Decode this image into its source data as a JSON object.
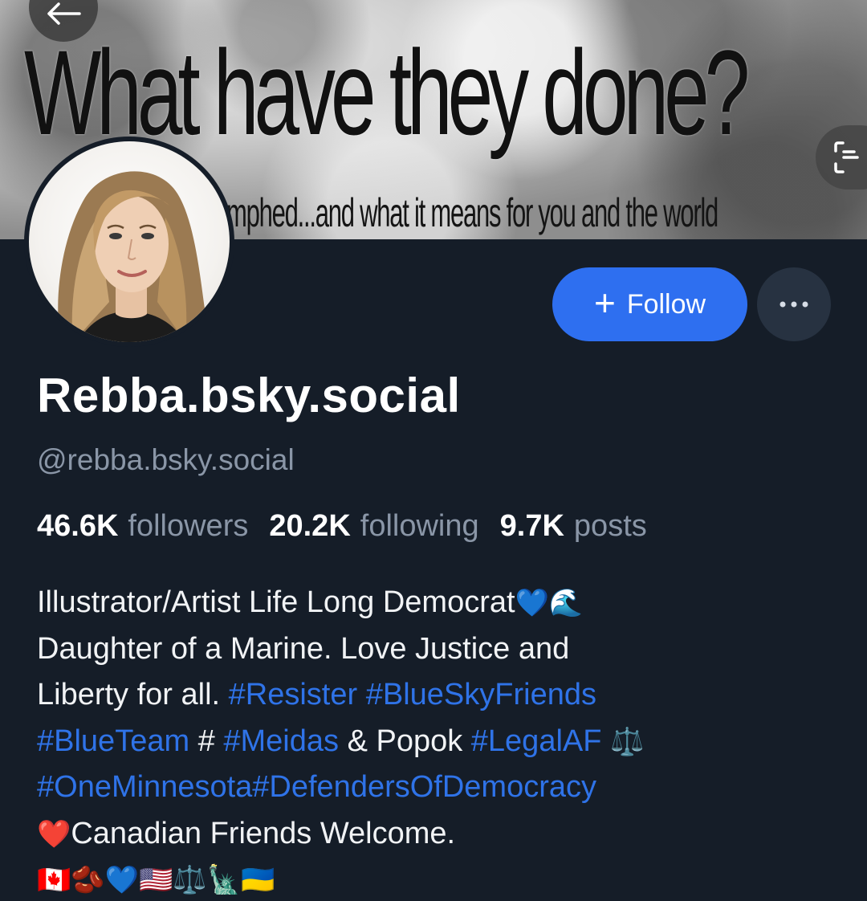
{
  "banner": {
    "headline": "What have they done?",
    "subline": "mphed...and what it means for you and the world"
  },
  "icons": {
    "back": "arrow-left-icon",
    "expand": "expand-icon",
    "more": "more-dots-icon",
    "plus": "plus-icon"
  },
  "actions": {
    "follow_label": "Follow",
    "follow_plus": "+"
  },
  "profile": {
    "display_name": "Rebba.bsky.social",
    "handle": "@rebba.bsky.social"
  },
  "stats": {
    "followers_value": "46.6K",
    "followers_label": "followers",
    "following_value": "20.2K",
    "following_label": "following",
    "posts_value": "9.7K",
    "posts_label": "posts"
  },
  "bio": {
    "line1_text": "Illustrator/Artist Life Long Democrat",
    "line1_emoji": "💙🌊",
    "line2_text": "Daughter of a Marine. Love Justice and",
    "line3_text": "Liberty for all. ",
    "line3_tag1": "#Resister",
    "line3_tag2": "#BlueSkyFriends",
    "line4_tag1": "#BlueTeam",
    "line4_text1": " # ",
    "line4_tag2": "#Meidas",
    "line4_text2": " & Popok ",
    "line4_tag3": "#LegalAF",
    "line4_emoji": " ⚖️",
    "line5_tag": "#OneMinnesota#DefendersOfDemocracy",
    "line6_emoji": "❤️",
    "line6_text": "Canadian Friends Welcome.",
    "line7_emoji": "🇨🇦🫘💙🇺🇸⚖️🗽🇺🇦"
  },
  "colors": {
    "background": "#151d28",
    "accent": "#2e6ff0",
    "hashtag": "#2f73e8",
    "muted_text": "#8a96a7"
  }
}
